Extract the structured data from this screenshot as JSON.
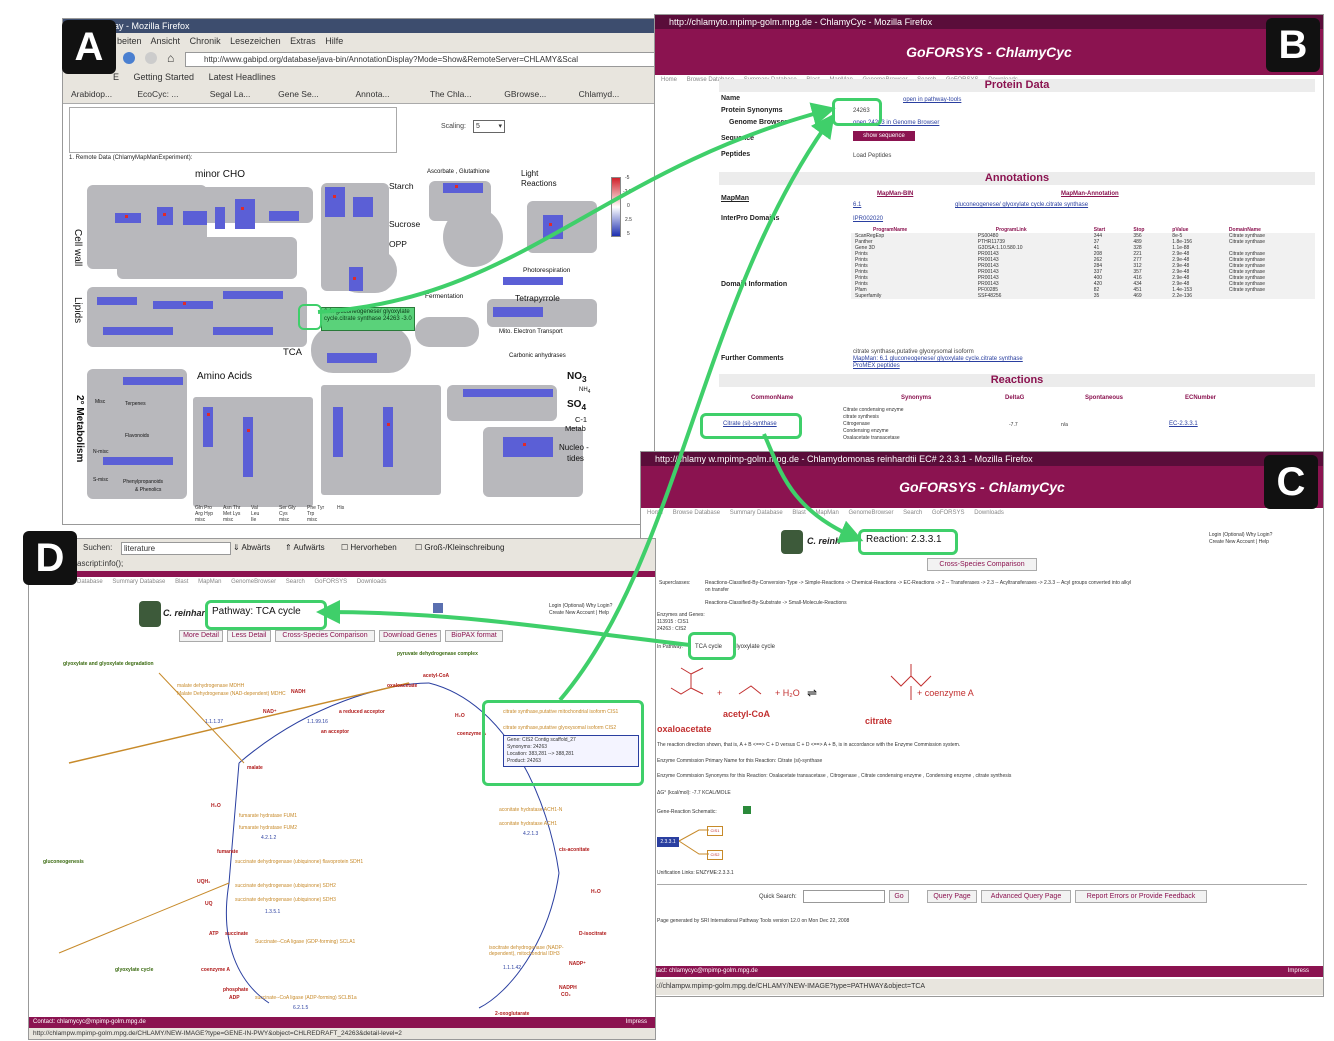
{
  "panels": {
    "a": "A",
    "b": "B",
    "c": "C",
    "d": "D"
  },
  "win_a": {
    "title": "tion Display - Mozilla Firefox",
    "menu": [
      "beiten",
      "Ansicht",
      "Chronik",
      "Lesezeichen",
      "Extras",
      "Hilfe"
    ],
    "url": "http://www.gabipd.org/database/java-bin/AnnotationDisplay?Mode=Show&RemoteServer=CHLAMY&Scal",
    "bookmarks_row1": [
      "E",
      "Getting Started",
      "Latest Headlines"
    ],
    "tabs": [
      "Arabidop...",
      "EcoCyc: ...",
      "Segal La...",
      "Gene Se...",
      "Annota...",
      "The Chla...",
      "GBrowse...",
      "Chlamyd..."
    ],
    "scaling_label": "Scaling:",
    "scaling_value": "5",
    "remote_data": "1. Remote Data (ChlamyMapManExperiment):",
    "tooltip": "6.1: gluconeogenese/ glyoxylate cycle.citrate synthase 24263 -3.0",
    "legend": [
      "-5",
      "-2.5",
      "0",
      "2.5",
      "5"
    ],
    "map_labels": {
      "minor_cho": "minor  CHO",
      "cell_wall": "Cell wall",
      "lipids": "Lipids",
      "starch": "Starch",
      "sucrose": "Sucrose",
      "opp": "OPP",
      "ascorbate": "Ascorbate , Glutathione",
      "light": "Light",
      "reactions": "Reactions",
      "photoresp": "Photorespiration",
      "fermentation": "Fermentation",
      "tetrapyrrole": "Tetrapyrrole",
      "mito": "Mito. Electron  Transport",
      "tca": "TCA",
      "carbonic": "Carbonic  anhydrases",
      "amino": "Amino  Acids",
      "no3": "NO",
      "no3_sub": "3",
      "nh4": "NH",
      "nh4_sub": "4",
      "so4": "SO",
      "so4_sub": "4",
      "c1": "C-1",
      "metab": "Metab",
      "nucleo": "Nucleo -",
      "tides": "tides",
      "secondary": "2° Metabolism",
      "misc": "Misc",
      "terpenes": "Terpenes",
      "flavonoids": "Flavonoids",
      "n_misc": "N-misc",
      "s_misc": "S-misc",
      "phenyl": "Phenylpropanoids",
      "phenolics": "& Phenolics",
      "aa": [
        "Gln Pro Arg Hyp misc",
        "Asn Thr Met Lys misc",
        "Val Leu Ile",
        "Ser Gly Cys misc",
        "Phe Tyr Trp misc",
        "His"
      ]
    }
  },
  "win_b": {
    "title": "http://chlamyto.mpimp-golm.mpg.de - ChlamyCyc - Mozilla Firefox",
    "banner": "GoFORSYS - ChlamyCyc",
    "nav": [
      "Home",
      "Browse Database",
      "Summary Database",
      "Blast",
      "MapMan",
      "GenomeBrowser",
      "Search",
      "GoFORSYS",
      "Downloads"
    ],
    "protein_data": "Protein Data",
    "labels": {
      "name": "Name",
      "synonyms": "Protein Synonyms",
      "genome": "Genome Browser",
      "sequence": "Sequence",
      "peptides": "Peptides",
      "mapman": "MapMan",
      "interpro": "InterPro Domains",
      "domain_info": "Domain Information",
      "further": "Further Comments"
    },
    "name_value": "open in pathway-tools",
    "synonym_value": "24263",
    "genome_value": "open 24263 in Genome Browser",
    "sequence_btn": "show sequence",
    "peptides_value": "Load Peptides",
    "annotations": "Annotations",
    "mapman_bin_header": "MapMan-BIN",
    "mapman_anno_header": "MapMan-Annotation",
    "mapman_bin": "6.1",
    "mapman_anno": "gluconeogenese/ glyoxylate cycle.citrate synthase",
    "interpro_value": "IPR002020",
    "domain_headers": [
      "ProgramName",
      "ProgramLink",
      "Start",
      "Stop",
      "pValue",
      "DomainName"
    ],
    "domain_rows": [
      [
        "ScanRegExp",
        "PS00480",
        "344",
        "356",
        "8e-5",
        "Citrate synthase"
      ],
      [
        "Panther",
        "PTHR11739",
        "37",
        "489",
        "1.8e-156",
        "Citrate synthase"
      ],
      [
        "Gene 3D",
        "G3DSA:1.10.580.10",
        "41",
        "328",
        "1.1e-88",
        ""
      ],
      [
        "Prints",
        "PR00143",
        "208",
        "221",
        "2.9e-48",
        "Citrate synthase"
      ],
      [
        "Prints",
        "PR00143",
        "262",
        "277",
        "2.9e-48",
        "Citrate synthase"
      ],
      [
        "Prints",
        "PR00143",
        "284",
        "312",
        "2.9e-48",
        "Citrate synthase"
      ],
      [
        "Prints",
        "PR00143",
        "337",
        "357",
        "2.9e-48",
        "Citrate synthase"
      ],
      [
        "Prints",
        "PR00143",
        "400",
        "416",
        "2.9e-48",
        "Citrate synthase"
      ],
      [
        "Prints",
        "PR00143",
        "420",
        "434",
        "2.9e-48",
        "Citrate synthase"
      ],
      [
        "Pfam",
        "PF00285",
        "82",
        "451",
        "1.4e-153",
        "Citrate synthase"
      ],
      [
        "Superfamily",
        "SSF48256",
        "35",
        "469",
        "2.2e-136",
        ""
      ]
    ],
    "further_1": "citrate synthase,putative glyoxysomal isoform",
    "further_2": "MapMan: 6.1 gluconeogenese/ glyoxylate cycle.citrate synthase",
    "further_3": "ProMEX peptides",
    "reactions": "Reactions",
    "react_headers": [
      "CommonName",
      "Synonyms",
      "DeltaG",
      "Spontaneous",
      "ECNumber"
    ],
    "react_common": "Citrate (si)-synthase",
    "react_synonyms": [
      "Citrate condensing enzyme",
      "citrate synthesis",
      "Citrogenase",
      "Condensing enzyme",
      "Oxalacetate transacetase"
    ],
    "react_deltag": "-7.7",
    "react_spont": "n/a",
    "react_ec": "EC-2.3.3.1"
  },
  "win_c": {
    "title": "http://chlamy   w.mpimp-golm.mpg.de - Chlamydomonas reinhardtii EC# 2.3.3.1 - Mozilla Firefox",
    "banner": "GoFORSYS - ChlamyCyc",
    "nav": [
      "Home",
      "Browse Database",
      "Summary Database",
      "Blast",
      "MapMan",
      "GenomeBrowser",
      "Search",
      "GoFORSYS",
      "Downloads"
    ],
    "organism": "C. reinh",
    "reaction_title": "Reaction: 2.3.3.1",
    "login": "Login (Optional)   Why Login?",
    "create": "Create New Account  |  Help",
    "compare_btn": "Cross-Species Comparison",
    "superclasses_label": "Superclasses:",
    "superclasses_1": "Reactions-Classified-By-Conversion-Type -> Simple-Reactions -> Chemical-Reactions -> EC-Reactions -> 2 -- Transferases -> 2.3 -- Acyltransferases -> 2.3.3 -- Acyl groups converted into alkyl",
    "superclasses_1b": "on transfer",
    "superclasses_2": "Reactions-Classified-By-Substrate -> Small-Molecule-Reactions",
    "enzymes_label": "Enzymes and Genes:",
    "enzyme_1": "113915 : CIS1",
    "enzyme_2": "24263 : CIS2",
    "pathway_label": "In Pathway:",
    "pathway_tca": "TCA cycle",
    "pathway_glyox": "glyoxylate cycle",
    "eq_plus1": "+",
    "eq_h2o": "+ H₂O",
    "eq_coa": "+ coenzyme A",
    "eq_oxaloacetate": "oxaloacetate",
    "eq_acetylcoa": "acetyl-CoA",
    "eq_citrate": "citrate",
    "direction": "The reaction direction shown, that is, A + B <==> C + D versus C + D <==> A + B, is in accordance with the Enzyme Commission system.",
    "primary_name": "Enzyme Commission Primary Name for this Reaction:  Citrate (si)-synthase",
    "synonyms": "Enzyme Commission Synonyms for this Reaction:  Oxalacetate transacetase ,  Citrogenase ,  Citrate condensing enzyme ,  Condensing enzyme ,  citrate synthesis",
    "delta_g": "ΔG° (kcal/mol):  -7.7 KCAL/MOLE",
    "schematic": "Gene-Reaction Schematic:",
    "schematic_box": "2.3.3.1",
    "schematic_cis1": "CIS1",
    "schematic_cis2": "CIS2",
    "unification": "Unification Links:  ENZYME:2.3.3.1",
    "quick_search": "Quick Search:",
    "go_btn": "Go",
    "query_btn": "Query Page",
    "adv_btn": "Advanced Query Page",
    "report_btn": "Report Errors or Provide Feedback",
    "generated": "Page generated by SRI International Pathway Tools version 12.0 on Mon Dec 22, 2008",
    "contact": "Contact: chlamycyc@mpimp-golm.mpg.de",
    "impress": "Impress",
    "status_url": "http://chlampw.mpimp-golm.mpg.de/CHLAMY/NEW-IMAGE?type=PATHWAY&object=TCA"
  },
  "win_d": {
    "search_label": "Suchen:",
    "search_value": "literature",
    "abwarts": "Abwärts",
    "aufwarts": "Aufwärts",
    "hervorheben": "Hervorheben",
    "gross": "Groß-/Kleinschreibung",
    "script": "ascript:info();",
    "nav": [
      "Database",
      "Summary Database",
      "Blast",
      "MapMan",
      "GenomeBrowser",
      "Search",
      "GoFORSYS",
      "Downloads"
    ],
    "organism": "C. reinhar",
    "pathway_title": "Pathway: TCA cycle",
    "login": "Login (Optional)   Why Login?",
    "create": "Create New Account  |  Help",
    "buttons": [
      "More Detail",
      "Less Detail",
      "Cross-Species Comparison",
      "Download Genes",
      "BioPAX format"
    ],
    "popup_line1": "Gene: CIS2 Contig scaffold_27",
    "popup_line2": "Synonyms: 24263",
    "popup_line3": "Location: 383,281 --> 388,281",
    "popup_line4": "Product: 24263",
    "nodes": {
      "glyox_degr": "glyoxylate and glyoxylate degradation",
      "pyruvate": "pyruvate dehydrogenase complex",
      "acetylcoa": "acetyl-CoA",
      "oxaloacetate": "oxaloacetate",
      "nadh": "NADH",
      "nad": "NAD⁺",
      "reduced": "a reduced acceptor",
      "acceptor": "an acceptor",
      "malate": "malate",
      "h2o_1": "H₂O",
      "h2o_2": "H₂O",
      "h2o_3": "H₂O",
      "coenzyme": "coenzyme A",
      "fumarate": "fumarate",
      "ubiquinol": "UQH₂",
      "uq": "UQ",
      "succinate": "succinate",
      "atp": "ATP",
      "coenzyme_a": "coenzyme A",
      "phosphate": "phosphate",
      "adp": "ADP",
      "gluconeo": "gluconeogenesis",
      "glyox_cycle": "glyoxylate cycle",
      "cisacon": "cis-aconitate",
      "isocitrate": "D-isocitrate",
      "nadp": "NADP⁺",
      "nadph": "NADPH",
      "co2": "CO₂",
      "oxoglut": "2-oxoglutarate"
    },
    "enz_mdh": "malate dehydrogenase   MDHH",
    "enz_mdh2": "Malate Dehydrogenase (NAD-dependent)  MDHC",
    "enz_ec1": "1.1.1.37",
    "enz_fum": "fumarate hydratase   FUM1",
    "enz_fum2": "fumarate hydratase   FUM2",
    "enz_ec2": "4.2.1.2",
    "enz_sdh": "succinate dehydrogenase (ubiquinone) flavoprotein  SDH1",
    "enz_sdh2": "succinate dehydrogenase (ubiquinone)  SDH2",
    "enz_sdh3": "succinate dehydrogenase (ubiquinone)  SDH3",
    "enz_ec3": "1.3.5.1",
    "enz_scl": "Succinate--CoA ligase (GDP-forming)   SCLA1",
    "enz_scl2": "succinate--CoA ligase (ADP-forming)   SCLB1a",
    "enz_ec4": "6.2.1.5",
    "enz_acon": "aconitate hydratase   ACH1-N",
    "enz_acon2": "aconitate hydratase   ACH1",
    "enz_ec5": "4.2.1.3",
    "enz_idh": "isocitrate dehydrogenase (NADP-dependent), mitochondrial   IDH3",
    "enz_ec6": "1.1.1.42",
    "enz_cis": "citrate synthase,putative mitochondrial isoform   CIS1",
    "enz_cis2": "citrate synthase,putative glyoxysomal isoform   CIS2",
    "enz_ec7": "1.1.99.16",
    "contact": "Contact: chlamycyc@mpimp-golm.mpg.de",
    "impress": "Impress",
    "status_url": "http://chlampw.mpimp-golm.mpg.de/CHLAMY/NEW-IMAGE?type=GENE-IN-PWY&object=CHLREDRAFT_24263&detail-level=2"
  },
  "colors": {
    "accent": "#8b1350",
    "highlight": "#3fcf6a",
    "map_blue": "#5b5fd6",
    "map_red": "#e02a2a"
  }
}
